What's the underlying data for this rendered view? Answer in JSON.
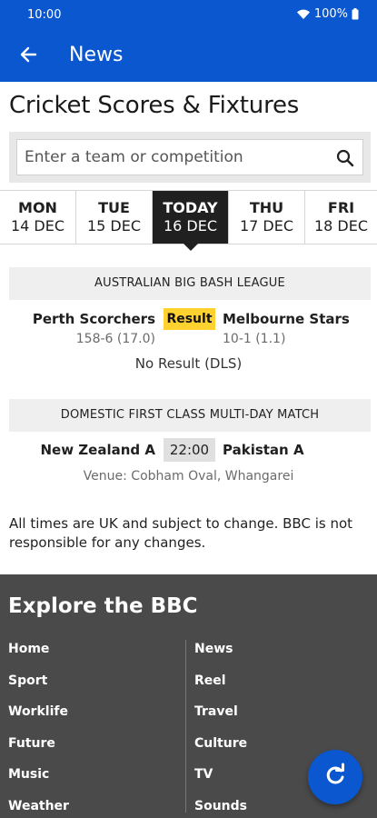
{
  "status_bar": {
    "time": "10:00",
    "battery": "100%"
  },
  "app_bar": {
    "title": "News"
  },
  "page": {
    "title": "Cricket Scores & Fixtures"
  },
  "search": {
    "placeholder": "Enter a team or competition"
  },
  "dates": [
    {
      "day": "MON",
      "date": "14 DEC"
    },
    {
      "day": "TUE",
      "date": "15 DEC"
    },
    {
      "day": "TODAY",
      "date": "16 DEC",
      "active": true
    },
    {
      "day": "THU",
      "date": "17 DEC"
    },
    {
      "day": "FRI",
      "date": "18 DEC"
    }
  ],
  "competitions": [
    {
      "name": "AUSTRALIAN BIG BASH LEAGUE",
      "match": {
        "home": "Perth Scorchers",
        "away": "Melbourne Stars",
        "status": "Result",
        "home_score": "158-6 (17.0)",
        "away_score": "10-1 (1.1)",
        "summary": "No Result (DLS)"
      }
    },
    {
      "name": "DOMESTIC FIRST CLASS MULTI-DAY MATCH",
      "match": {
        "home": "New Zealand A",
        "away": "Pakistan A",
        "time": "22:00",
        "venue": "Venue: Cobham Oval, Whangarei"
      }
    }
  ],
  "disclaimer": "All times are UK and subject to change. BBC is not responsible for any changes.",
  "footer": {
    "title": "Explore the BBC",
    "left_links": [
      "Home",
      "Sport",
      "Worklife",
      "Future",
      "Music",
      "Weather"
    ],
    "right_links": [
      "News",
      "Reel",
      "Travel",
      "Culture",
      "TV",
      "Sounds"
    ]
  },
  "colors": {
    "brand_blue": "#0a57d0",
    "result_yellow": "#ffd230",
    "footer_bg": "#4a4a4a"
  },
  "icons": {
    "back": "arrow-left-icon",
    "search": "search-icon",
    "refresh": "refresh-icon"
  }
}
